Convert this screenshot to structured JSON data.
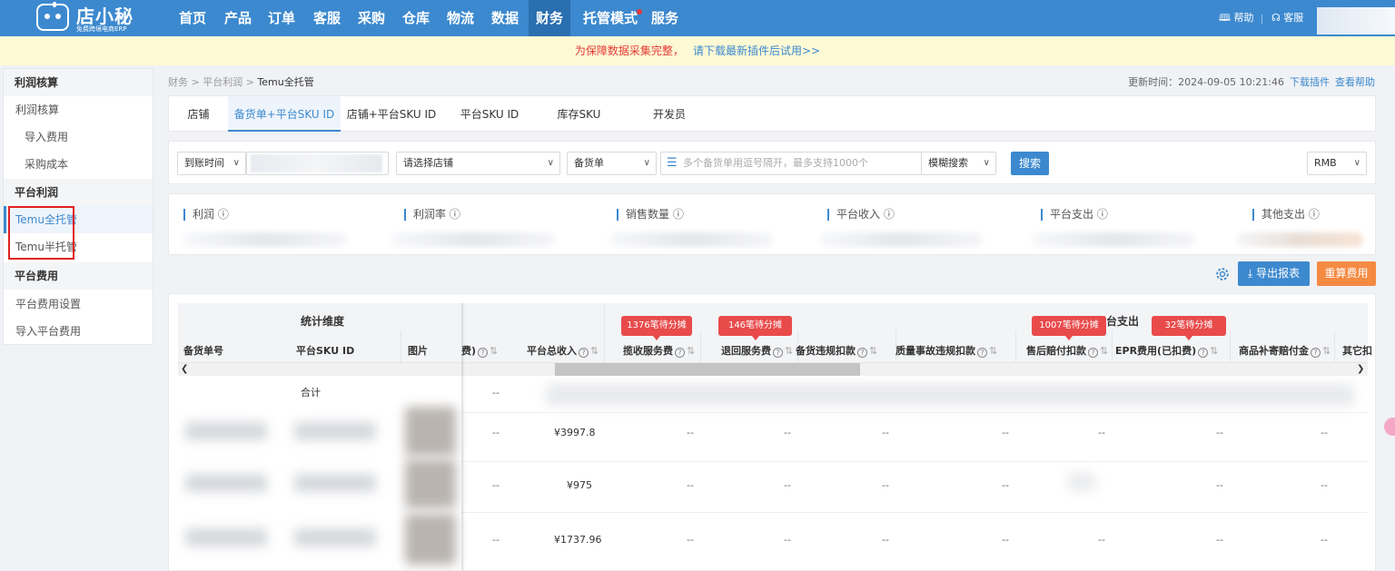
{
  "app": {
    "logo_title": "店小秘",
    "logo_subtitle": "免费跨境电商ERP"
  },
  "nav": {
    "items": [
      "首页",
      "产品",
      "订单",
      "客服",
      "采购",
      "仓库",
      "物流",
      "数据",
      "财务",
      "托管模式",
      "服务"
    ],
    "active": "财务",
    "help": "帮助",
    "service": "客服"
  },
  "notice": {
    "warning": "为保障数据采集完整，",
    "link": "请下载最新插件后试用>>"
  },
  "sidebar": {
    "sections": [
      {
        "title": "利润核算",
        "items": [
          "利润核算",
          "导入费用",
          "采购成本"
        ]
      },
      {
        "title": "平台利润",
        "items": [
          "Temu全托管",
          "Temu半托管"
        ]
      },
      {
        "title": "平台费用",
        "items": [
          "平台费用设置",
          "导入平台费用"
        ]
      }
    ],
    "active_item": "Temu全托管"
  },
  "breadcrumb": {
    "items": [
      "财务",
      "平台利润"
    ],
    "current": "Temu全托管",
    "separator": ">"
  },
  "update": {
    "label": "更新时间：2024-09-05 10:21:46",
    "download_plugin": "下载插件",
    "view_help": "查看帮助"
  },
  "tabs": {
    "items": [
      "店铺",
      "备货单+平台SKU ID",
      "店铺+平台SKU ID",
      "平台SKU ID",
      "库存SKU",
      "开发员"
    ],
    "active": "备货单+平台SKU ID"
  },
  "filters": {
    "date_type": "到账时间",
    "store_placeholder": "请选择店铺",
    "doc_type": "备货单",
    "doc_placeholder": "多个备货单用逗号隔开，最多支持1000个",
    "match_mode": "模糊搜索",
    "search_button": "搜索",
    "currency": "RMB"
  },
  "stats": {
    "items": [
      "利润",
      "利润率",
      "销售数量",
      "平台收入",
      "平台支出",
      "其他支出"
    ]
  },
  "actions": {
    "export": "导出报表",
    "recalc": "重算费用"
  },
  "table": {
    "group_fixed": "统计维度",
    "group_platform_expense": "平台支出",
    "fixed_columns": [
      "备货单号",
      "平台SKU ID",
      "图片"
    ],
    "partial_column": "费)",
    "columns": [
      "平台总收入",
      "揽收服务费",
      "退回服务费",
      "备货违规扣款",
      "质量事故违规扣款",
      "售后赔付扣款",
      "EPR费用(已扣费)",
      "商品补寄赔付金",
      "其它扣"
    ],
    "badges": [
      "1376笔待分摊",
      "146笔待分摊",
      "1007笔待分摊",
      "32笔待分摊"
    ],
    "total_label": "合计",
    "dash": "--",
    "rows": [
      {
        "income": "¥3997.8"
      },
      {
        "income": "¥975"
      },
      {
        "income": "¥1737.96"
      }
    ]
  },
  "colors": {
    "primary": "#3c89cf",
    "nav_active": "#2a6fb0",
    "warning": "#e53935",
    "badge": "#e94b4b",
    "recalc": "#f58a43",
    "notice_bg": "#fdf9d5"
  }
}
